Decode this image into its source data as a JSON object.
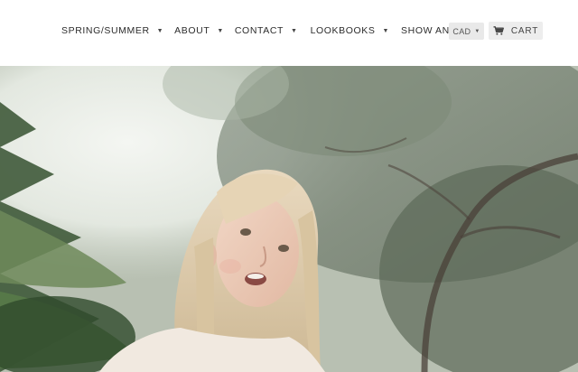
{
  "nav": {
    "items": [
      {
        "label": "SPRING/SUMMER",
        "has_dropdown": true
      },
      {
        "label": "ABOUT",
        "has_dropdown": true
      },
      {
        "label": "CONTACT",
        "has_dropdown": true
      },
      {
        "label": "LOOKBOOKS",
        "has_dropdown": true
      },
      {
        "label": "SHOW AND TELL",
        "has_dropdown": false
      }
    ],
    "search_icon": "search-icon"
  },
  "currency": {
    "selected": "CAD"
  },
  "cart": {
    "label": "CART",
    "icon": "cart-icon"
  },
  "hero": {
    "description": "child-under-trees-photo"
  },
  "colors": {
    "text": "#2b2b2b",
    "button_bg": "#ededed",
    "background": "#ffffff"
  }
}
